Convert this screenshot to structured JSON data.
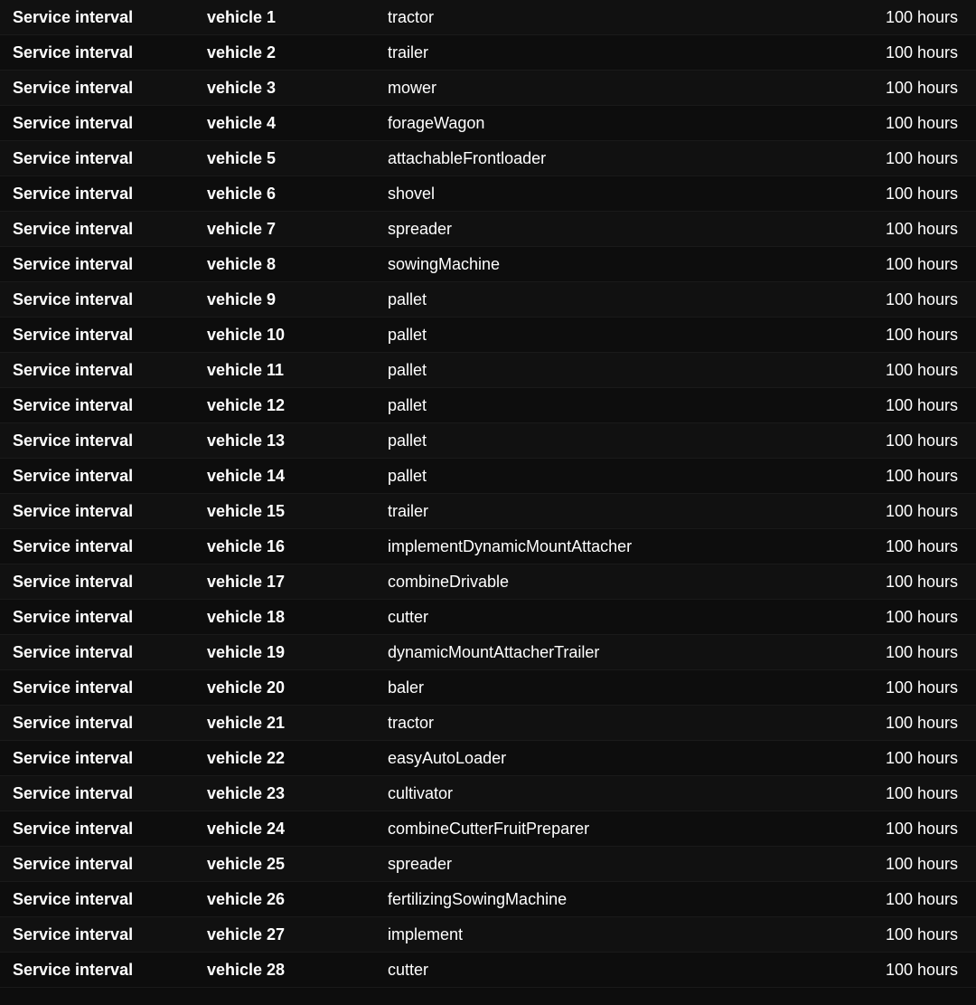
{
  "rows": [
    {
      "label": "Service interval",
      "vehicle": "vehicle 1",
      "type": "tractor",
      "value": "100 hours"
    },
    {
      "label": "Service interval",
      "vehicle": "vehicle 2",
      "type": "trailer",
      "value": "100 hours"
    },
    {
      "label": "Service interval",
      "vehicle": "vehicle 3",
      "type": "mower",
      "value": "100 hours"
    },
    {
      "label": "Service interval",
      "vehicle": "vehicle 4",
      "type": "forageWagon",
      "value": "100 hours"
    },
    {
      "label": "Service interval",
      "vehicle": "vehicle 5",
      "type": "attachableFrontloader",
      "value": "100 hours"
    },
    {
      "label": "Service interval",
      "vehicle": "vehicle 6",
      "type": "shovel",
      "value": "100 hours"
    },
    {
      "label": "Service interval",
      "vehicle": "vehicle 7",
      "type": "spreader",
      "value": "100 hours"
    },
    {
      "label": "Service interval",
      "vehicle": "vehicle 8",
      "type": "sowingMachine",
      "value": "100 hours"
    },
    {
      "label": "Service interval",
      "vehicle": "vehicle 9",
      "type": "pallet",
      "value": "100 hours"
    },
    {
      "label": "Service interval",
      "vehicle": "vehicle 10",
      "type": "pallet",
      "value": "100 hours"
    },
    {
      "label": "Service interval",
      "vehicle": "vehicle 11",
      "type": "pallet",
      "value": "100 hours"
    },
    {
      "label": "Service interval",
      "vehicle": "vehicle 12",
      "type": "pallet",
      "value": "100 hours"
    },
    {
      "label": "Service interval",
      "vehicle": "vehicle 13",
      "type": "pallet",
      "value": "100 hours"
    },
    {
      "label": "Service interval",
      "vehicle": "vehicle 14",
      "type": "pallet",
      "value": "100 hours"
    },
    {
      "label": "Service interval",
      "vehicle": "vehicle 15",
      "type": "trailer",
      "value": "100 hours"
    },
    {
      "label": "Service interval",
      "vehicle": "vehicle 16",
      "type": "implementDynamicMountAttacher",
      "value": "100 hours"
    },
    {
      "label": "Service interval",
      "vehicle": "vehicle 17",
      "type": "combineDrivable",
      "value": "100 hours"
    },
    {
      "label": "Service interval",
      "vehicle": "vehicle 18",
      "type": "cutter",
      "value": "100 hours"
    },
    {
      "label": "Service interval",
      "vehicle": "vehicle 19",
      "type": "dynamicMountAttacherTrailer",
      "value": "100 hours"
    },
    {
      "label": "Service interval",
      "vehicle": "vehicle 20",
      "type": "baler",
      "value": "100 hours"
    },
    {
      "label": "Service interval",
      "vehicle": "vehicle 21",
      "type": "tractor",
      "value": "100 hours"
    },
    {
      "label": "Service interval",
      "vehicle": "vehicle 22",
      "type": "easyAutoLoader",
      "value": "100 hours"
    },
    {
      "label": "Service interval",
      "vehicle": "vehicle 23",
      "type": "cultivator",
      "value": "100 hours"
    },
    {
      "label": "Service interval",
      "vehicle": "vehicle 24",
      "type": "combineCutterFruitPreparer",
      "value": "100 hours"
    },
    {
      "label": "Service interval",
      "vehicle": "vehicle 25",
      "type": "spreader",
      "value": "100 hours"
    },
    {
      "label": "Service interval",
      "vehicle": "vehicle 26",
      "type": "fertilizingSowingMachine",
      "value": "100 hours"
    },
    {
      "label": "Service interval",
      "vehicle": "vehicle 27",
      "type": "implement",
      "value": "100 hours"
    },
    {
      "label": "Service interval",
      "vehicle": "vehicle 28",
      "type": "cutter",
      "value": "100 hours"
    }
  ]
}
